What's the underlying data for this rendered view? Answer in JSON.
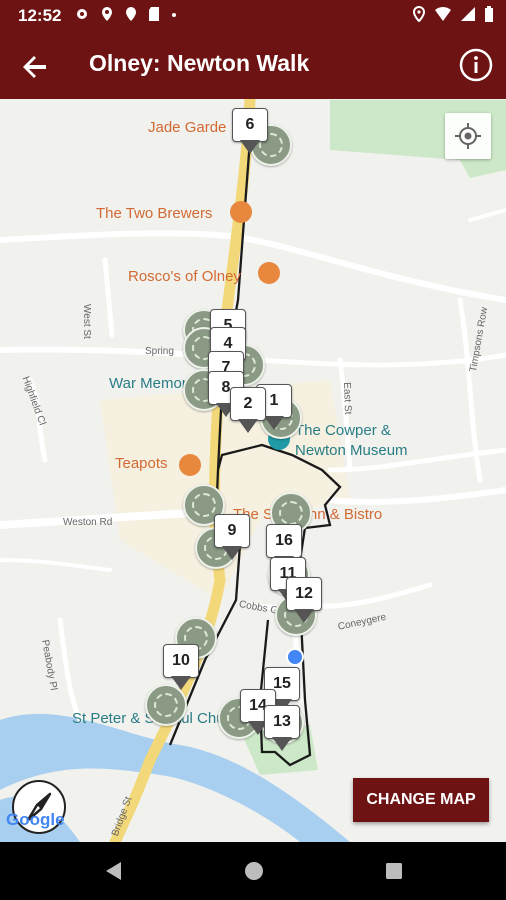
{
  "status_bar": {
    "time": "12:52",
    "left_icons": [
      "gear-icon",
      "location-pin-icon",
      "map-pin-icon",
      "sd-card-icon",
      "dot-icon"
    ],
    "right_icons": [
      "location-icon",
      "wifi-icon",
      "signal-icon",
      "battery-icon"
    ]
  },
  "app_bar": {
    "title": "Olney: Newton Walk",
    "back_icon": "arrow-left-icon",
    "info_icon": "info-icon"
  },
  "map": {
    "places": [
      {
        "label": "Jade Garde",
        "kind": "orange"
      },
      {
        "label": "The Two Brewers",
        "kind": "orange"
      },
      {
        "label": "Rosco's of Olney",
        "kind": "orange"
      },
      {
        "label": "War Memor",
        "kind": "teal"
      },
      {
        "label": "The Cowper &",
        "kind": "teal"
      },
      {
        "label": "Newton Museum",
        "kind": "teal"
      },
      {
        "label": "Teapots",
        "kind": "orange"
      },
      {
        "label": "The Swan Inn & Bistro",
        "kind": "orange"
      },
      {
        "label": "St Peter & St Paul Chu",
        "kind": "teal"
      }
    ],
    "streets": [
      "West St",
      "Spring",
      "Highfield Cl",
      "East St",
      "Timpsons Row",
      "Weston Rd",
      "Cobbs Garden",
      "Peabody Pl",
      "Bridge St",
      "Coneygere"
    ],
    "markers": [
      "6",
      "5",
      "4",
      "7",
      "8",
      "2",
      "1",
      "9",
      "16",
      "11",
      "12",
      "10",
      "15",
      "14",
      "13"
    ]
  },
  "controls": {
    "my_location_icon": "my-location-icon",
    "compass_icon": "compass-icon",
    "google_logo": "Google",
    "change_map_label": "CHANGE MAP"
  },
  "nav_bar": {
    "back": "nav-back-icon",
    "home": "nav-home-icon",
    "recents": "nav-recents-icon"
  }
}
